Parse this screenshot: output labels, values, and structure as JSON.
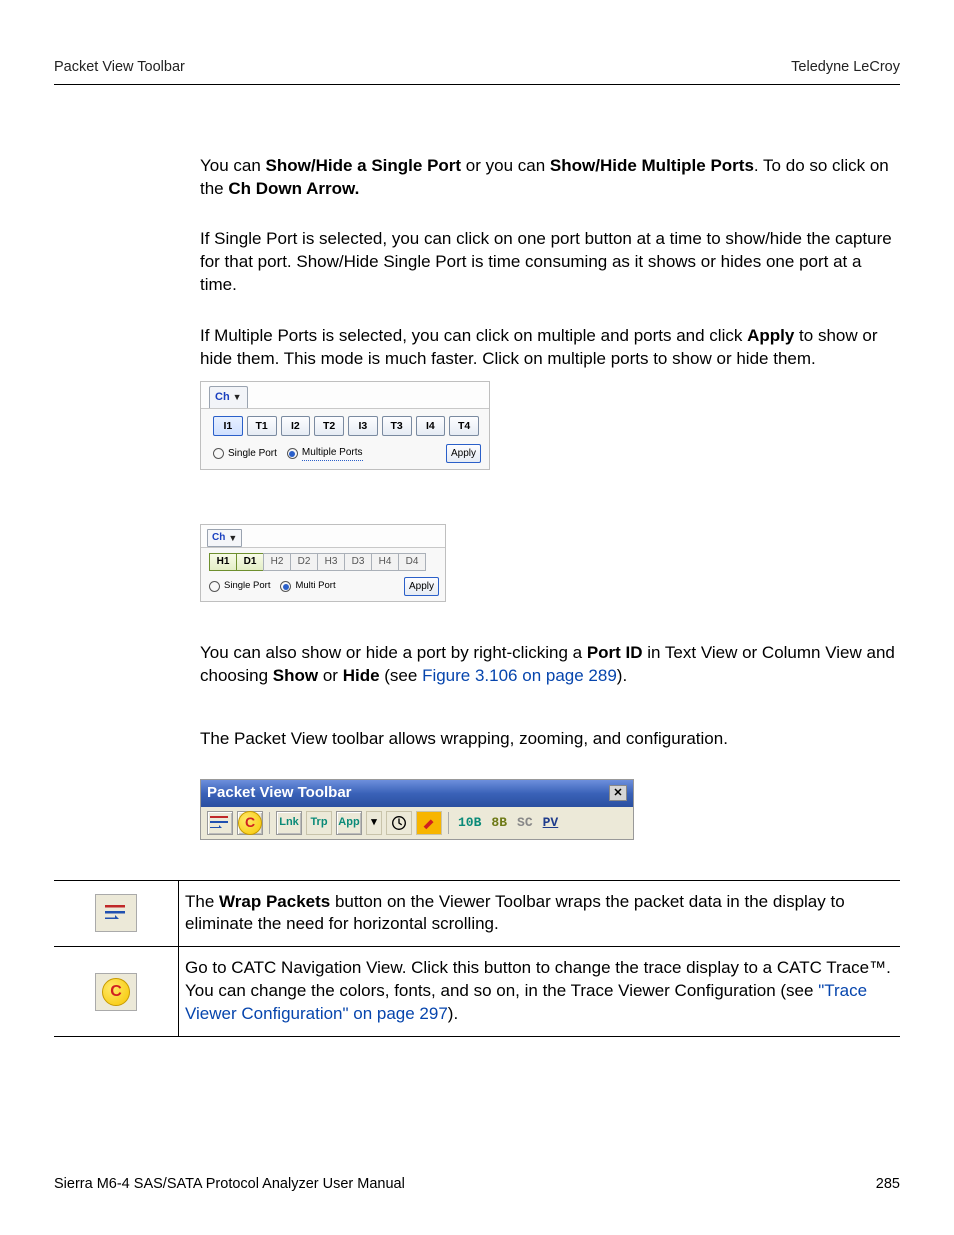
{
  "header": {
    "left": "Packet View Toolbar",
    "right": "Teledyne LeCroy"
  },
  "para1": {
    "pre": "You can ",
    "b1": "Show/Hide a Single Port",
    "mid": " or you can ",
    "b2": "Show/Hide Multiple Ports",
    "post": ". To do so click on the ",
    "b3": "Ch Down Arrow.",
    "tail": ""
  },
  "para2": "If Single Port is selected, you can click on one port button at a time to show/hide the capture for that port. Show/Hide Single Port is time consuming as it shows or hides one port at a time.",
  "para3": {
    "pre": "If Multiple Ports is selected, you can click on multiple and ports and click ",
    "b1": "Apply",
    "post": " to show or hide them. This mode is much faster. Click on multiple ports to show or hide them."
  },
  "panel1": {
    "tab": "Ch",
    "ports": [
      "I1",
      "T1",
      "I2",
      "T2",
      "I3",
      "T3",
      "I4",
      "T4"
    ],
    "radio_single": "Single Port",
    "radio_multi": "Multiple Ports",
    "apply": "Apply"
  },
  "panel2": {
    "tab": "Ch",
    "ports": [
      "H1",
      "D1",
      "H2",
      "D2",
      "H3",
      "D3",
      "H4",
      "D4"
    ],
    "radio_single": "Single Port",
    "radio_multi": "Multi Port",
    "apply": "Apply"
  },
  "para4": {
    "pre": "You can also show or hide a port by right-clicking a ",
    "b1": "Port ID",
    "mid": " in Text View or Column View and choosing ",
    "b2": "Show",
    "or": " or ",
    "b3": "Hide",
    "see_pre": " (see ",
    "link": "Figure 3.106 on page 289",
    "see_post": ")."
  },
  "para5": "The Packet View toolbar allows wrapping, zooming, and configuration.",
  "toolbar": {
    "title": "Packet View Toolbar",
    "items": {
      "lnk": "Lnk",
      "trp": "Trp",
      "app": "App",
      "t10": "10B",
      "t8": "8B",
      "sc": "SC",
      "pv": "PV"
    }
  },
  "table": {
    "row1": {
      "pre": "The ",
      "b": "Wrap Packets",
      "post": " button on the Viewer Toolbar wraps the packet data in the display to eliminate the need for horizontal scrolling."
    },
    "row2": {
      "line1": "Go to CATC Navigation View. Click this button to change the trace display to a CATC Trace™.",
      "line2a": "You can change the colors, fonts, and so on, in the Trace Viewer Configuration (see ",
      "link": "\"Trace Viewer Configuration\" on page 297",
      "line2b": ")."
    }
  },
  "footer": {
    "left": "Sierra M6-4 SAS/SATA Protocol Analyzer User Manual",
    "right": "285"
  }
}
